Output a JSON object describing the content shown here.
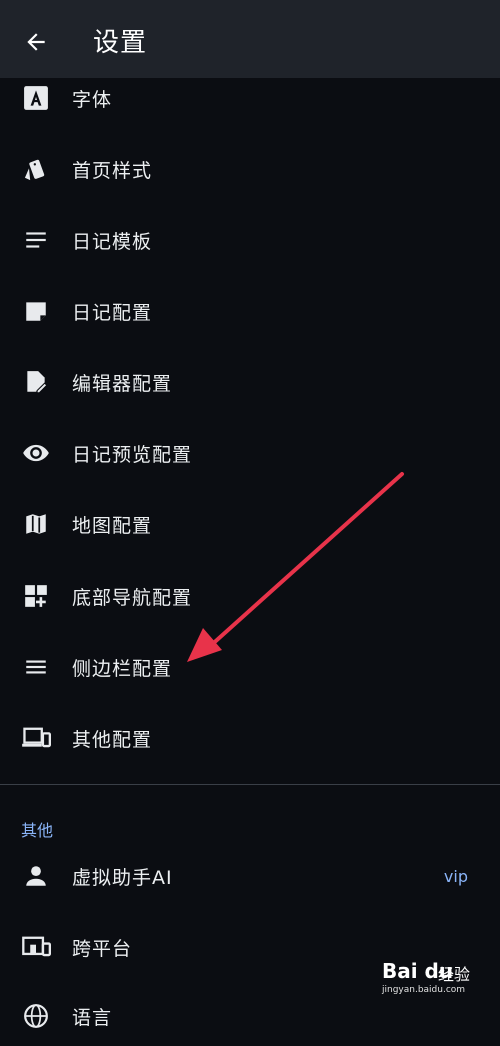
{
  "appbar": {
    "title": "设置",
    "back_icon": "arrow-left-icon"
  },
  "items": [
    {
      "label": "字体",
      "icon": "font-a-icon"
    },
    {
      "label": "首页样式",
      "icon": "style-cards-icon"
    },
    {
      "label": "日记模板",
      "icon": "notes-lines-icon"
    },
    {
      "label": "日记配置",
      "icon": "note-folded-icon"
    },
    {
      "label": "编辑器配置",
      "icon": "edit-document-icon"
    },
    {
      "label": "日记预览配置",
      "icon": "eye-icon"
    },
    {
      "label": "地图配置",
      "icon": "map-icon"
    },
    {
      "label": "底部导航配置",
      "icon": "grid-add-icon"
    },
    {
      "label": "侧边栏配置",
      "icon": "menu-icon"
    },
    {
      "label": "其他配置",
      "icon": "devices-icon"
    }
  ],
  "section_other": {
    "header": "其他",
    "items": [
      {
        "label": "虚拟助手AI",
        "icon": "person-icon",
        "badge": "vip"
      },
      {
        "label": "跨平台",
        "icon": "devices-other-icon"
      },
      {
        "label": "语言",
        "icon": "globe-icon"
      }
    ]
  },
  "colors": {
    "background": "#0b0d12",
    "appbar": "#1f232a",
    "accent": "#8ab4f8",
    "annotation_arrow": "#e8334a"
  },
  "watermark": {
    "logo": "Bai du",
    "brand": "经验",
    "url": "jingyan.baidu.com"
  }
}
